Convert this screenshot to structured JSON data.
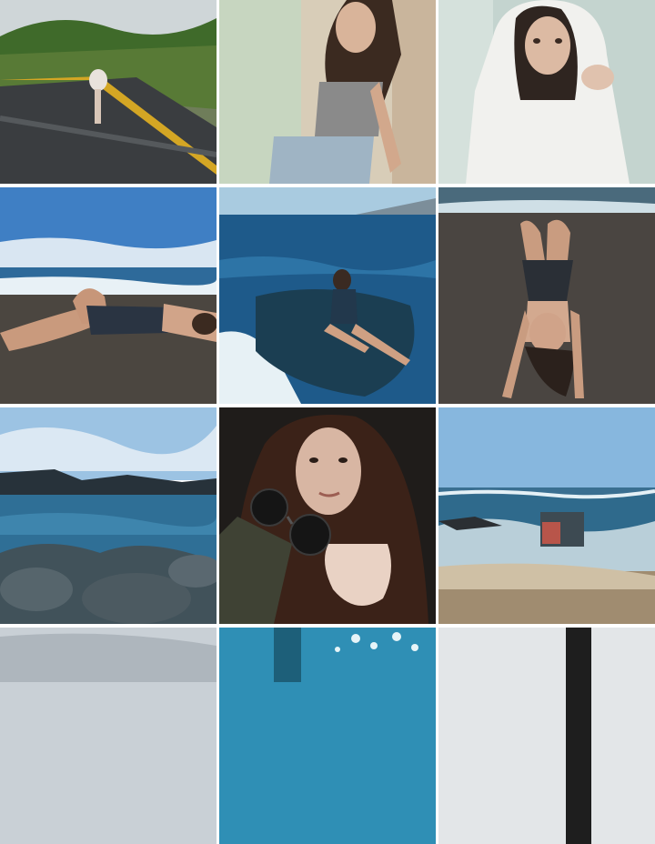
{
  "grid": {
    "tiles": [
      {
        "photo_icon": "photo-road-runner"
      },
      {
        "photo_icon": "photo-wall-pose"
      },
      {
        "photo_icon": "photo-white-hoodie"
      },
      {
        "photo_icon": "photo-beach-reclining"
      },
      {
        "photo_icon": "photo-ocean-rocks-sitting"
      },
      {
        "photo_icon": "photo-black-sand-lying"
      },
      {
        "photo_icon": "photo-rocky-coast"
      },
      {
        "photo_icon": "photo-sunglasses-portrait"
      },
      {
        "photo_icon": "photo-beach-waves"
      },
      {
        "photo_icon": "photo-partial-sky"
      },
      {
        "photo_icon": "photo-partial-mural"
      },
      {
        "photo_icon": "photo-partial-pole"
      }
    ]
  }
}
